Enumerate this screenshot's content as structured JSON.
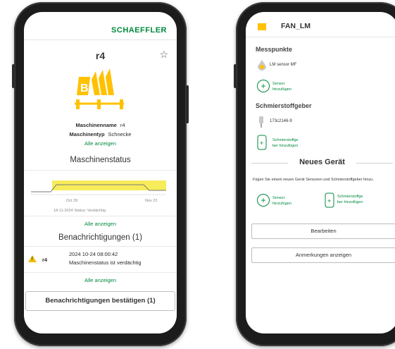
{
  "left": {
    "brand": "SCHAEFFLER",
    "machine_title": "r4",
    "machine_letter": "B",
    "details": [
      {
        "label": "Maschinenname",
        "value": "r4"
      },
      {
        "label": "Maschinentyp",
        "value": "Schnecke"
      }
    ],
    "show_all": "Alle anzeigen",
    "status_title": "Maschinenstatus",
    "chart": {
      "x_labels": [
        "Oct 29",
        "Nov 22"
      ],
      "status_text": "18-11-2024 Status: Verdächtig"
    },
    "notifications_title": "Benachrichtigungen (1)",
    "notification": {
      "machine": "r4",
      "date": "2024 10-24 08:00:42",
      "message": "Maschinenstatus ist  verdächtig"
    },
    "ack_button": "Benachrichtigungen bestätigen (1)"
  },
  "right": {
    "device_name": "FAN_LM",
    "measure_title": "Messpunkte",
    "sensor_label": "LM sensor MF",
    "add_sensor": [
      "Sensor",
      "hinzufügen"
    ],
    "lubricant_title": "Schmierstoffgeber",
    "lubricant_id": "173c2146-9",
    "add_lubricant": [
      "Schmierstoffge",
      "ber hinzufügen"
    ],
    "new_device_title": "Neues Gerät",
    "info": "Fügen Sie einem neuen Gerät Sensoren und Schmierstoffgeber hinzu.",
    "add_sensor_2": [
      "Sensor",
      "hinzufügen"
    ],
    "add_lubricant_2": [
      "Schmierstoffge",
      "ber hinzufügen"
    ],
    "edit_button": "Bearbeiten",
    "notes_button": "Anmerkungen anzeigen"
  },
  "colors": {
    "brand_green": "#00893d",
    "accent_yellow": "#ffc100",
    "chart_fill": "#f7ec5a"
  }
}
